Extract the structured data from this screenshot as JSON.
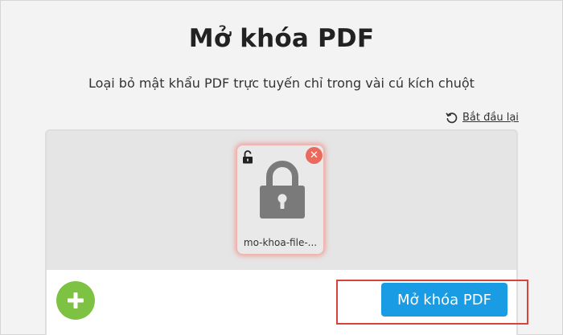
{
  "header": {
    "title": "Mở khóa PDF",
    "subtitle": "Loại bỏ mật khẩu PDF trực tuyến chỉ trong vài cú kích chuột"
  },
  "toolbar": {
    "restart_label": "Bắt đầu lại",
    "restart_icon": "restart-icon"
  },
  "file_card": {
    "file_name": "mo-khoa-file-...",
    "status_icon": "unlocked-icon",
    "preview_icon": "lock-icon",
    "remove_icon": "close-icon",
    "remove_glyph": "✕"
  },
  "actions": {
    "add_icon": "plus-icon",
    "unlock_label": "Mở khóa PDF"
  },
  "colors": {
    "primary_button": "#1a9ce4",
    "add_button": "#7dc242",
    "remove_button": "#ea6a5e",
    "highlight_border": "#d9433a"
  }
}
